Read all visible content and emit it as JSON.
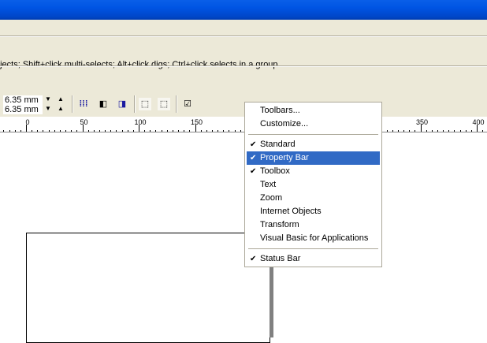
{
  "status_text": "ojects; Shift+click multi-selects; Alt+click digs; Ctrl+click selects in a group",
  "toolbar": {
    "nudge_offset": "6.35 mm",
    "super_nudge_offset": "6.35 mm"
  },
  "ruler": {
    "labels": [
      "0",
      "50",
      "100",
      "150",
      "350",
      "400"
    ]
  },
  "menu": {
    "items": [
      {
        "label": "Toolbars...",
        "checked": false
      },
      {
        "label": "Customize...",
        "checked": false
      },
      {
        "label": "Standard",
        "checked": true
      },
      {
        "label": "Property Bar",
        "checked": true,
        "highlighted": true
      },
      {
        "label": "Toolbox",
        "checked": true
      },
      {
        "label": "Text",
        "checked": false
      },
      {
        "label": "Zoom",
        "checked": false
      },
      {
        "label": "Internet Objects",
        "checked": false
      },
      {
        "label": "Transform",
        "checked": false
      },
      {
        "label": "Visual Basic for Applications",
        "checked": false
      },
      {
        "label": "Status Bar",
        "checked": true
      }
    ]
  },
  "colors": {
    "highlight": "#316ac5",
    "titlebar": "#0054e3",
    "chrome": "#ece9d8"
  }
}
